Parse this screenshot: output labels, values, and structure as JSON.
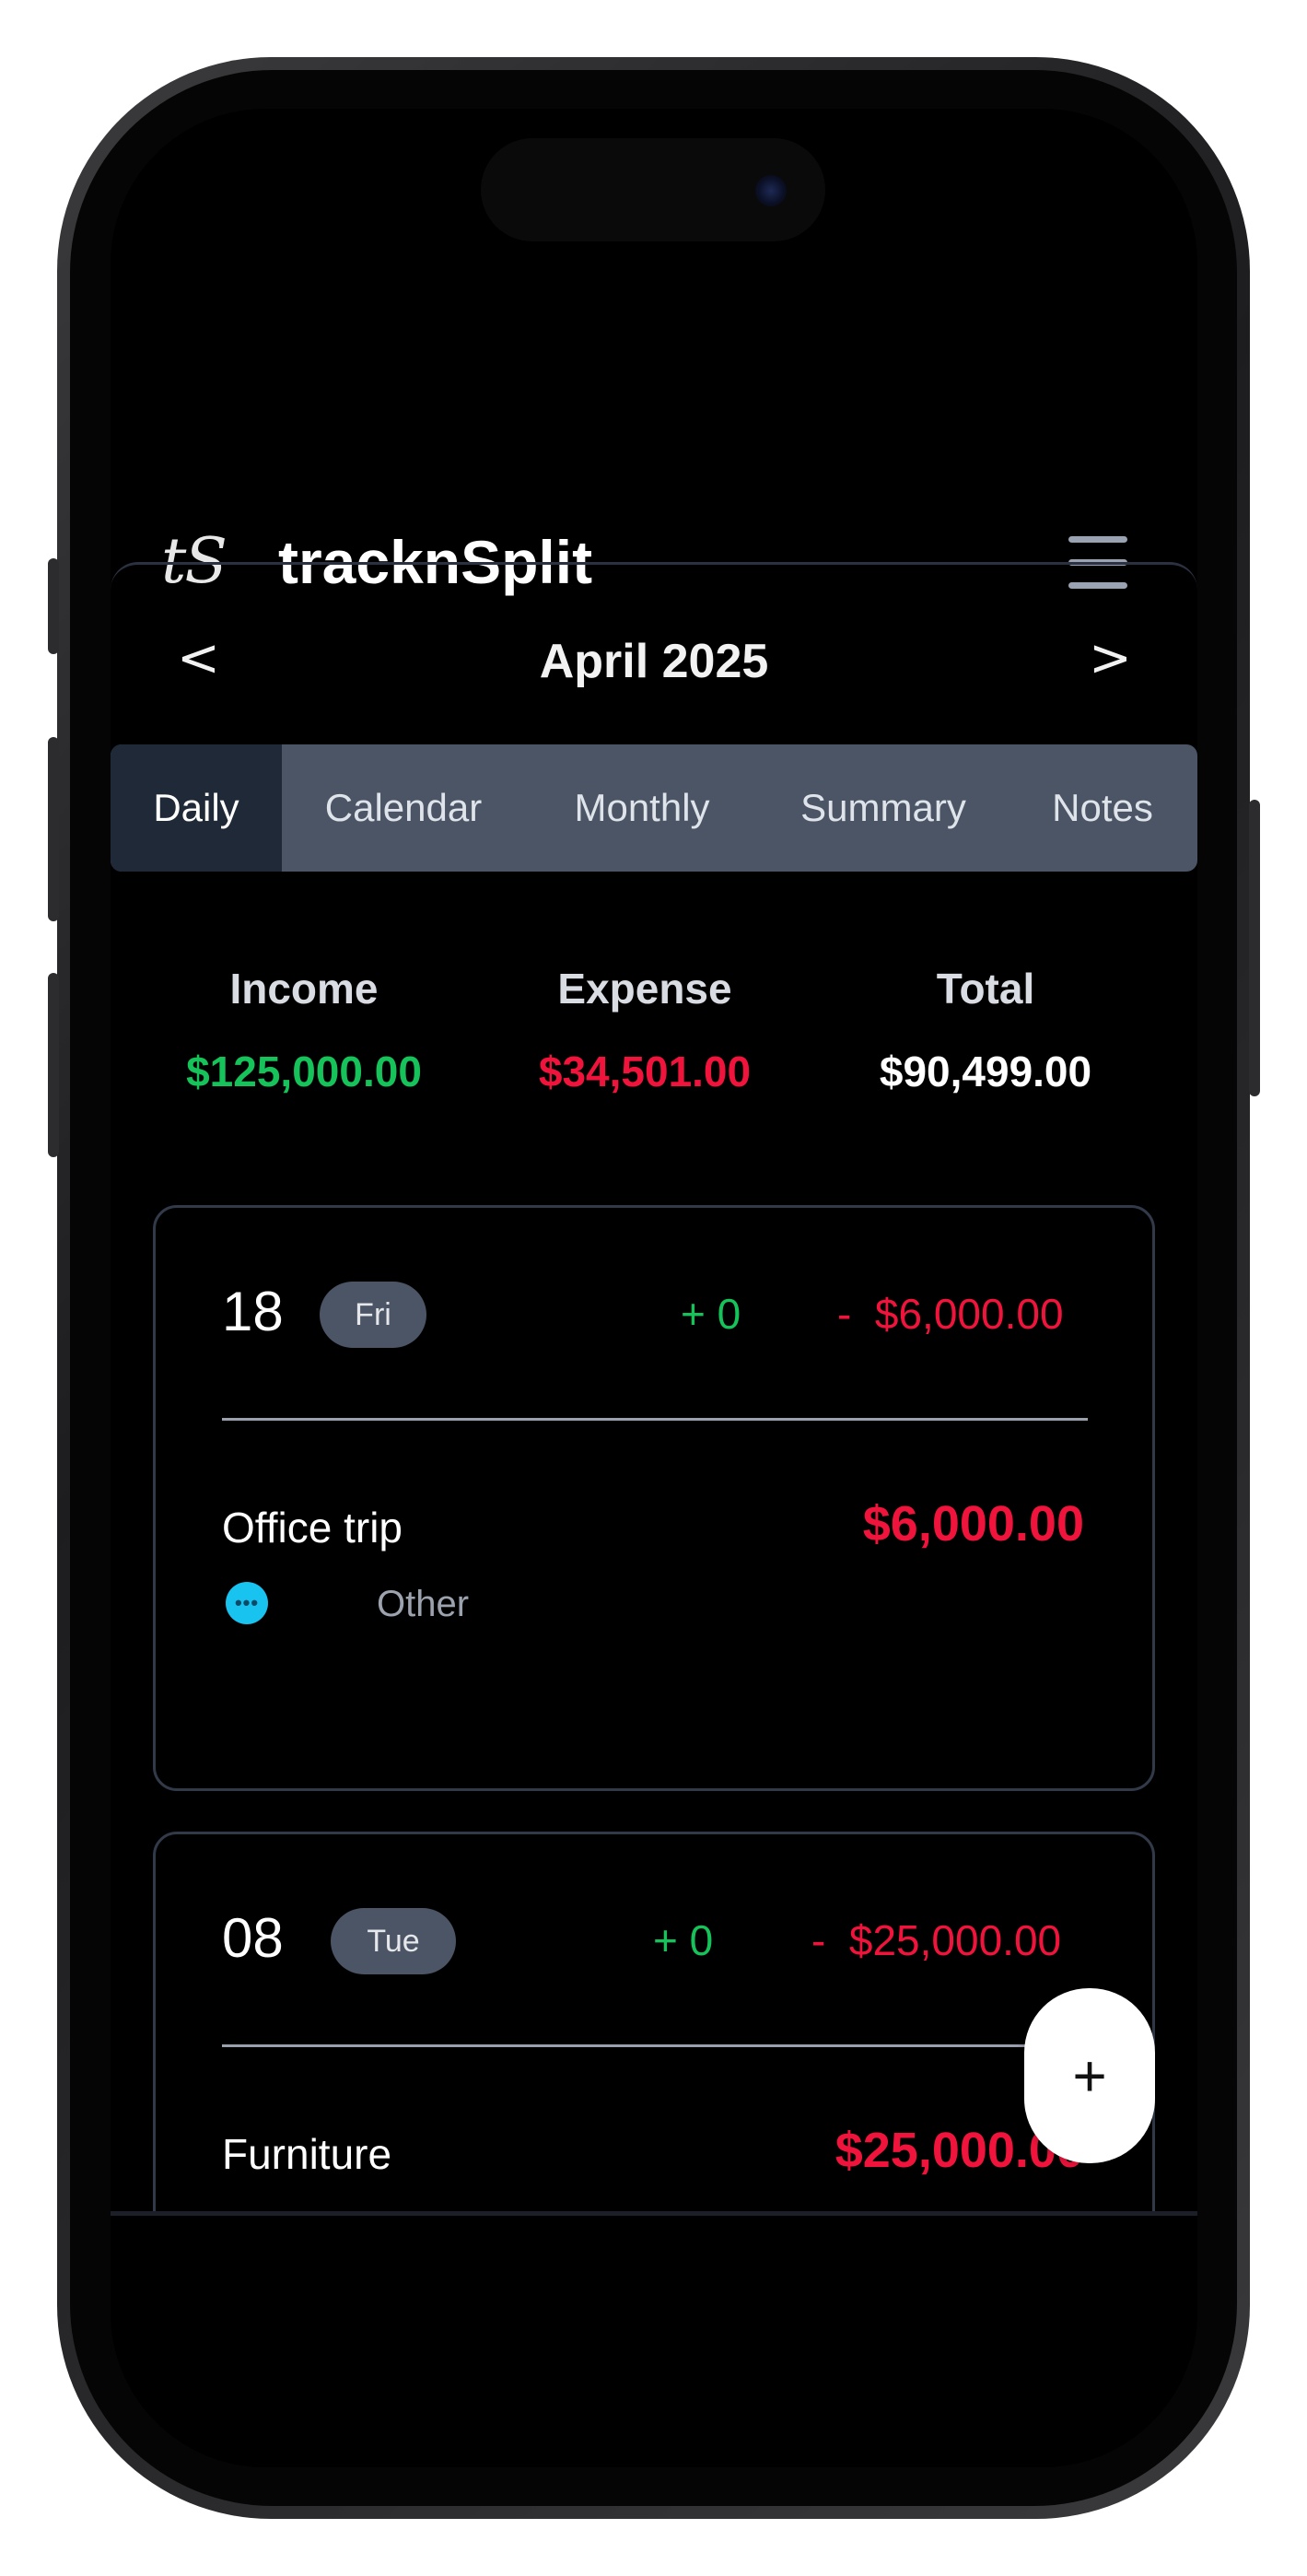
{
  "app": {
    "logo": "tS",
    "title": "tracknSplit"
  },
  "nav": {
    "prev": "<",
    "month": "April 2025",
    "next": ">"
  },
  "tabs": [
    {
      "label": "Daily",
      "active": true
    },
    {
      "label": "Calendar",
      "active": false
    },
    {
      "label": "Monthly",
      "active": false
    },
    {
      "label": "Summary",
      "active": false
    },
    {
      "label": "Notes",
      "active": false
    }
  ],
  "totals": {
    "income": {
      "label": "Income",
      "value": "$125,000.00",
      "color": "#16c25a"
    },
    "expense": {
      "label": "Expense",
      "value": "$34,501.00",
      "color": "#f0143c"
    },
    "total": {
      "label": "Total",
      "value": "$90,499.00",
      "color": "#ffffff"
    }
  },
  "days": [
    {
      "day": "18",
      "weekday": "Fri",
      "income": "+ 0",
      "expense": "-  $6,000.00",
      "entries": [
        {
          "title": "Office trip",
          "amount": "$6,000.00",
          "category": "Other",
          "icon": "dots-icon",
          "icon_glyph": "•••"
        }
      ]
    },
    {
      "day": "08",
      "weekday": "Tue",
      "income": "+ 0",
      "expense": "-  $25,000.00",
      "entries": [
        {
          "title": "Furniture",
          "amount": "$25,000.00"
        }
      ]
    }
  ],
  "fab": {
    "label": "+"
  },
  "colors": {
    "income": "#16c25a",
    "expense": "#f0143c",
    "tab_active": "#1f2937",
    "tab_bg": "#4b5565"
  }
}
